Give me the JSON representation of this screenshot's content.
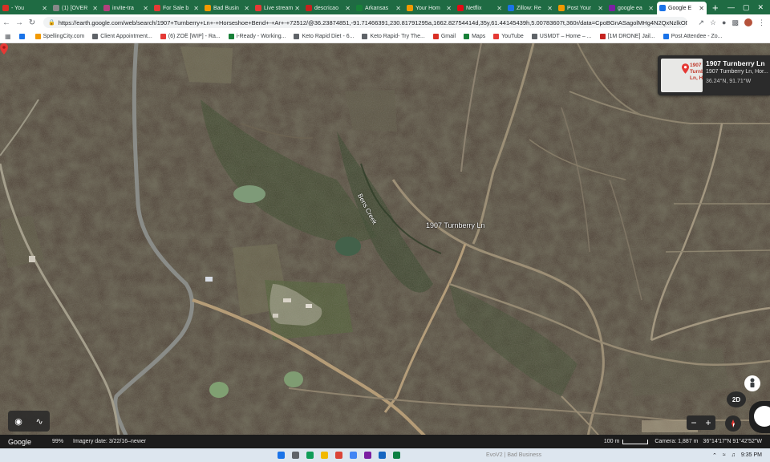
{
  "browser": {
    "tabs": [
      {
        "label": "- You",
        "color": "#d93025",
        "active": false
      },
      {
        "label": "(1) [OVER",
        "color": "#888888",
        "active": false
      },
      {
        "label": "invite-tra",
        "color": "#b3407d",
        "active": false
      },
      {
        "label": "For Sale b",
        "color": "#e53935",
        "active": false
      },
      {
        "label": "Bad Busin",
        "color": "#f29900",
        "active": false
      },
      {
        "label": "Live stream",
        "color": "#e53935",
        "active": false
      },
      {
        "label": "descricao",
        "color": "#c5221f",
        "active": false
      },
      {
        "label": "Arkansas",
        "color": "#188038",
        "active": false
      },
      {
        "label": "Your Hom",
        "color": "#f29900",
        "active": false
      },
      {
        "label": "Netflix",
        "color": "#e50914",
        "active": false
      },
      {
        "label": "Zillow: Re",
        "color": "#1a73e8",
        "active": false
      },
      {
        "label": "Post Your",
        "color": "#f29900",
        "active": false
      },
      {
        "label": "google ea",
        "color": "#7b1fa2",
        "active": false
      },
      {
        "label": "Google E",
        "color": "#1a73e8",
        "active": true
      }
    ],
    "url": "https://earth.google.com/web/search/1907+Turnberry+Ln+-+Horseshoe+Bend+-+Ar+-+72512/@36.23874851,-91.71466391,230.81791295a,1662.82754414d,35y,61.44145439h,5.00783607t,360r/data=CpoBGnASagolMHg4N2QxNzlkODUzYWQy...",
    "bookmarks": [
      {
        "label": "",
        "color": "#1a73e8"
      },
      {
        "label": "SpellingCity.com",
        "color": "#f29900"
      },
      {
        "label": "Client Appointment...",
        "color": "#5f6368"
      },
      {
        "label": "(6) ZOË [WIP] - Ra...",
        "color": "#e53935"
      },
      {
        "label": "i-Ready - Working...",
        "color": "#188038"
      },
      {
        "label": "Keto Rapid Diet - 6...",
        "color": "#5f6368"
      },
      {
        "label": "Keto Rapid- Try The...",
        "color": "#5f6368"
      },
      {
        "label": "Gmail",
        "color": "#d93025"
      },
      {
        "label": "Maps",
        "color": "#188038"
      },
      {
        "label": "YouTube",
        "color": "#e53935"
      },
      {
        "label": "USMDT – Home – ...",
        "color": "#5f6368"
      },
      {
        "label": "[1M DRONE] Jail...",
        "color": "#c5221f"
      },
      {
        "label": "Post Attendee - Zo...",
        "color": "#1a73e8"
      }
    ]
  },
  "map": {
    "pin_label": "1907 Turnberry Ln",
    "creek_label": "Bens Creek"
  },
  "info_card": {
    "thumb_text": "1907 Turnberry Ln, H",
    "title": "1907 Turnberry Ln",
    "subtitle": "1907 Turnberry Ln, Hor...",
    "coords": "36.24°N, 91.71°W"
  },
  "controls": {
    "btn_2d": "2D",
    "zoom_out": "−",
    "zoom_in": "+"
  },
  "status": {
    "logo": "Google",
    "zoom_pct": "99%",
    "imagery_date": "Imagery date: 3/22/16–newer",
    "scale": "100 m",
    "camera": "Camera: 1,887 m",
    "coords": "36°14'17\"N 91°42'52\"W"
  },
  "taskbar": {
    "window_label": "EvoV2 | Bad Business",
    "time": "9:35 PM"
  }
}
